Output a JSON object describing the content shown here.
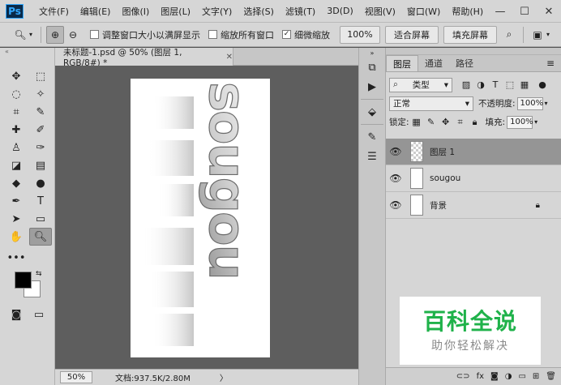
{
  "app": {
    "logo": "Ps"
  },
  "menu": [
    "文件(F)",
    "编辑(E)",
    "图像(I)",
    "图层(L)",
    "文字(Y)",
    "选择(S)",
    "滤镜(T)",
    "3D(D)",
    "视图(V)",
    "窗口(W)",
    "帮助(H)"
  ],
  "window_controls": {
    "minimize": "—",
    "maximize": "☐",
    "close": "✕"
  },
  "options": {
    "resize_window_label": "调整窗口大小以满屏显示",
    "resize_window_checked": false,
    "zoom_all_label": "缩放所有窗口",
    "zoom_all_checked": false,
    "scrubby_zoom_label": "细微缩放",
    "scrubby_zoom_checked": true,
    "btn_100": "100%",
    "btn_fit": "适合屏幕",
    "btn_fill": "填充屏幕"
  },
  "document": {
    "tab_title": "未标题-1.psd @ 50% (图层 1, RGB/8#) *",
    "artwork_text": "sougou"
  },
  "status": {
    "zoom": "50%",
    "doc_info": "文档:937.5K/2.80M",
    "arrow": "〉"
  },
  "layers_panel": {
    "tabs": [
      "图层",
      "通道",
      "路径"
    ],
    "filter_kind": "类型",
    "blend_mode": "正常",
    "opacity_label": "不透明度:",
    "opacity_value": "100%",
    "lock_label": "锁定:",
    "fill_label": "填充:",
    "fill_value": "100%",
    "layers": [
      {
        "name": "图层 1",
        "selected": true,
        "locked": false,
        "thumb": "checker"
      },
      {
        "name": "sougou",
        "selected": false,
        "locked": false,
        "thumb": "text"
      },
      {
        "name": "背景",
        "selected": false,
        "locked": true,
        "thumb": "white"
      }
    ]
  },
  "watermark": {
    "title": "百科全说",
    "subtitle": "助你轻松解决"
  }
}
